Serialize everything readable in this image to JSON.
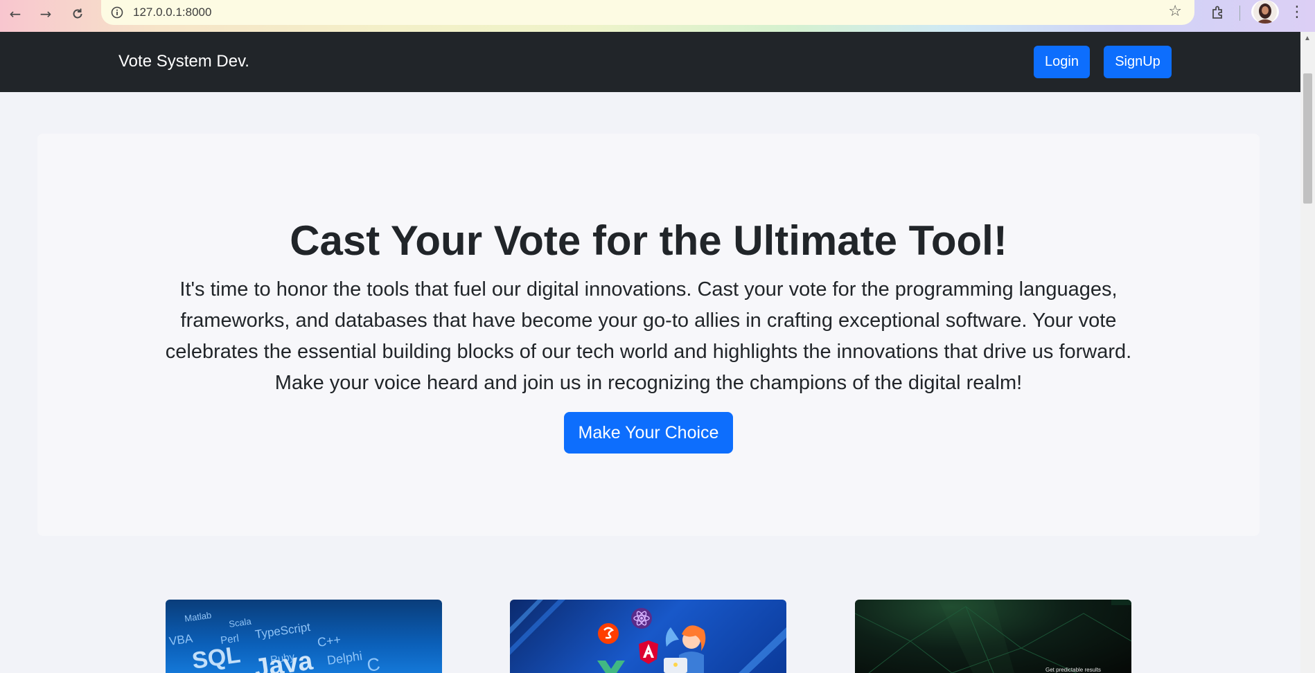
{
  "browser": {
    "url": "127.0.0.1:8000"
  },
  "navbar": {
    "brand": "Vote System Dev.",
    "login_label": "Login",
    "signup_label": "SignUp"
  },
  "hero": {
    "title": "Cast Your Vote for the Ultimate Tool!",
    "text": "It's time to honor the tools that fuel our digital innovations. Cast your vote for the programming languages, frameworks, and databases that have become your go-to allies in crafting exceptional software. Your vote celebrates the essential building blocks of our tech world and highlights the innovations that drive us forward. Make your voice heard and join us in recognizing the champions of the digital realm!",
    "cta_label": "Make Your Choice"
  },
  "cards": [
    {
      "words": [
        "Matlab",
        "Scala",
        "VBA",
        "Perl",
        "TypeScript",
        "SQL",
        "C++",
        "Ruby",
        "Java",
        "Delphi",
        "C"
      ]
    },
    {
      "icons": [
        "svelte-icon",
        "react-icon",
        "angular-icon",
        "vue-icon"
      ]
    },
    {
      "caption": "Get predictable results"
    }
  ],
  "colors": {
    "primary": "#0d6efd",
    "navbar": "#212529",
    "page_bg": "#f2f3f8",
    "hero_bg": "#f7f7fa"
  }
}
